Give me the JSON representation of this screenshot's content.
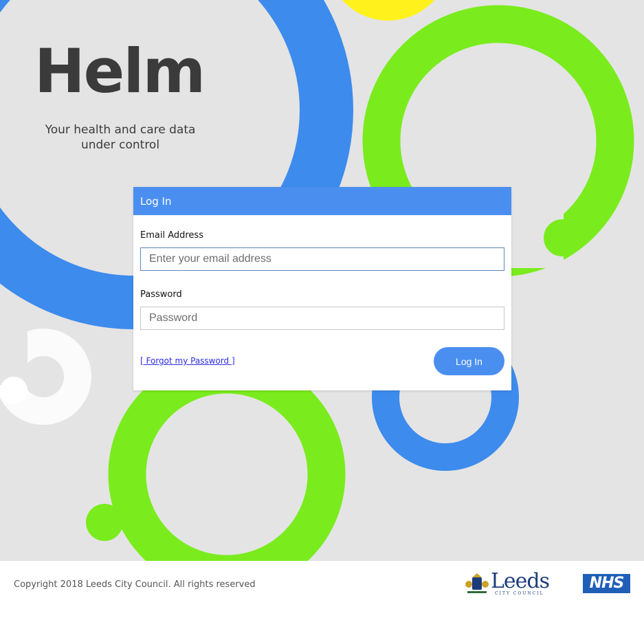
{
  "brand": {
    "name": "Helm",
    "tagline_line1": "Your health and care data",
    "tagline_line2": "under control"
  },
  "login": {
    "header_title": "Log In",
    "email_label": "Email Address",
    "email_placeholder": "Enter your email address",
    "email_value": "",
    "password_label": "Password",
    "password_placeholder": "Password",
    "password_value": "",
    "forgot_link": "[ Forgot my Password ]",
    "submit_label": "Log In"
  },
  "footer": {
    "copyright": "Copyright 2018 Leeds City Council. All rights reserved",
    "leeds_logo_text": "Leeds",
    "leeds_logo_subtext": "CITY COUNCIL",
    "nhs_logo_text": "NHS"
  },
  "colors": {
    "accent_blue": "#4a8ff0",
    "ring_blue": "#3d8bec",
    "ring_green": "#7aec1e",
    "ring_yellow": "#fff21c",
    "background": "#e4e4e4",
    "nhs_blue": "#1f5fb8"
  }
}
